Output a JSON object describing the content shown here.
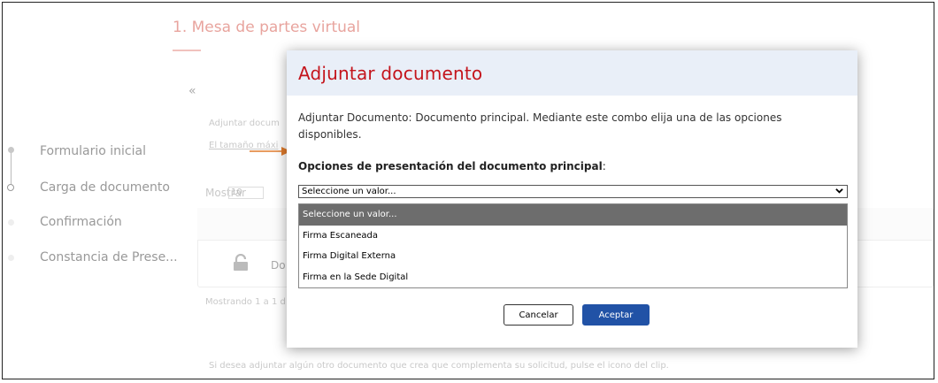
{
  "page": {
    "title": "1. Mesa de partes virtual",
    "collapse_icon": "«",
    "hint_adjuntar": "Adjuntar docum",
    "hint_tamano": "El tamaño máxi",
    "show_label": "Mostrar",
    "show_value": "10",
    "row_text": "Do",
    "showing_text": "Mostrando 1 a 1 d",
    "footer_hint": "Si desea adjuntar algún otro documento que crea que complementa su solicitud, pulse el icono del clip."
  },
  "steps": [
    {
      "label": "Formulario inicial"
    },
    {
      "label": "Carga de documento"
    },
    {
      "label": "Confirmación"
    },
    {
      "label": "Constancia de Prese..."
    }
  ],
  "modal": {
    "title": "Adjuntar documento",
    "description": "Adjuntar Documento: Documento principal. Mediante este combo elija una de las opciones disponibles.",
    "options_label": "Opciones de presentación del documento principal",
    "options_colon": ":",
    "select_value": "Seleccione un valor...",
    "dropdown_options": [
      "Seleccione un valor...",
      "Firma Escaneada",
      "Firma Digital Externa",
      "Firma en la Sede Digital"
    ],
    "cancel_label": "Cancelar",
    "accept_label": "Aceptar"
  },
  "colors": {
    "modal_title": "#c4141c",
    "header_bg": "#e9eff8",
    "accept_bg": "#2152a6",
    "selected_option_bg": "#6d6d6d",
    "annotation_arrow": "#e07b2c"
  }
}
